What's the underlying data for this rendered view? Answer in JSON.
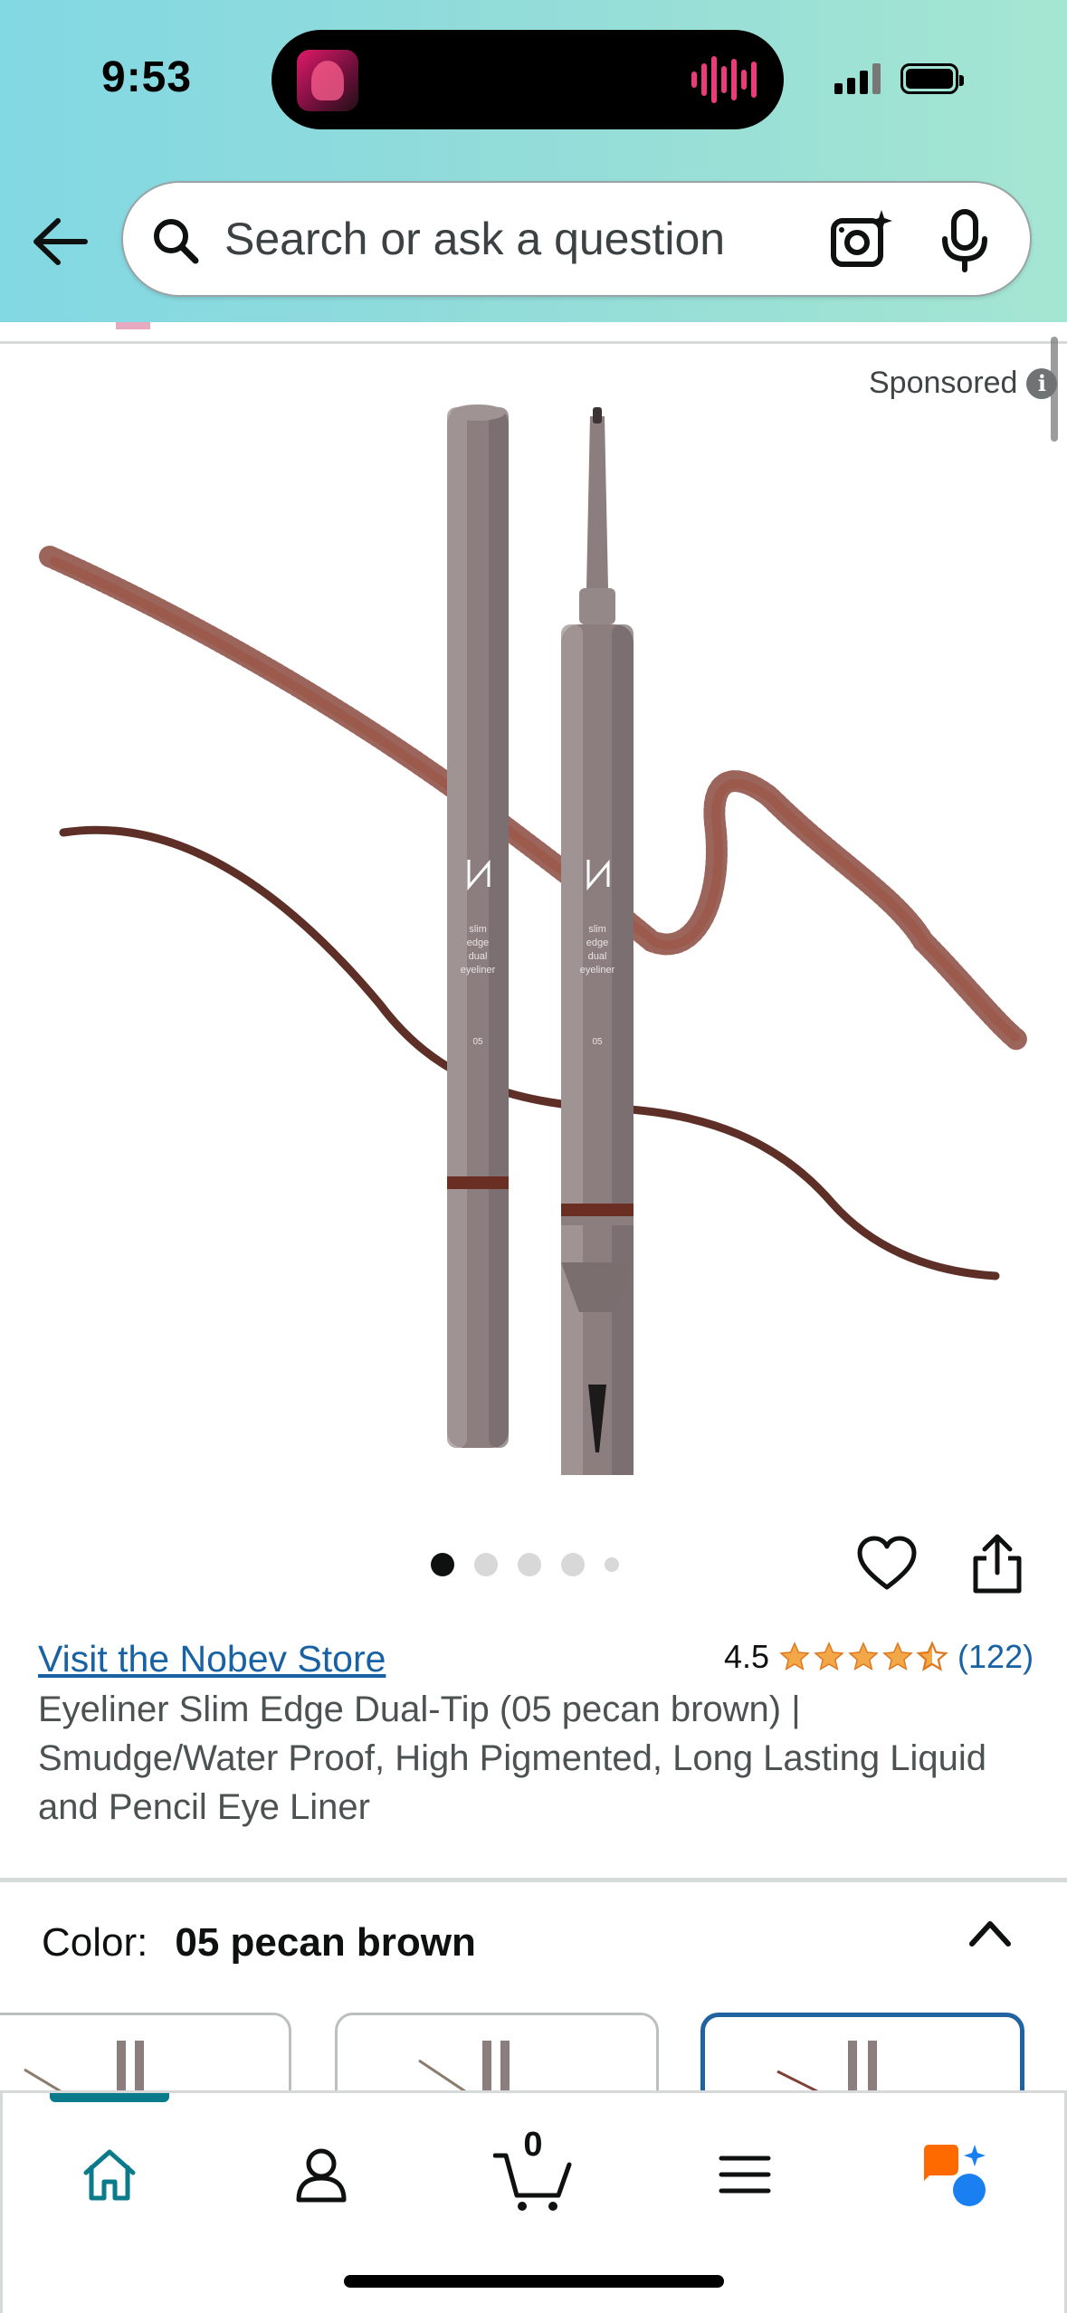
{
  "status_bar": {
    "time": "9:53"
  },
  "search": {
    "placeholder": "Search or ask a question"
  },
  "ad": {
    "sponsored_label": "Sponsored",
    "info_icon": "i"
  },
  "carousel": {
    "total": 5,
    "active_index": 0
  },
  "product": {
    "store_link": "Visit the Nobev Store",
    "rating": "4.5",
    "stars": 4.5,
    "rating_count": "(122)",
    "title": "Eyeliner Slim Edge Dual-Tip (05 pecan brown) | Smudge/Water Proof, High Pigmented, Long Lasting Liquid and Pencil Eye Liner"
  },
  "color_selector": {
    "label": "Color:",
    "value": "05 pecan brown"
  },
  "bottom_nav": {
    "cart_count": "0",
    "items": [
      "home-icon",
      "account-icon",
      "cart-icon",
      "menu-icon",
      "rufus-icon"
    ]
  },
  "colors": {
    "accent": "#0b7b8b",
    "link": "#1862a3",
    "star": "#f3a847",
    "swatch_selected": "#2162a1",
    "liner": "#7c4137"
  }
}
